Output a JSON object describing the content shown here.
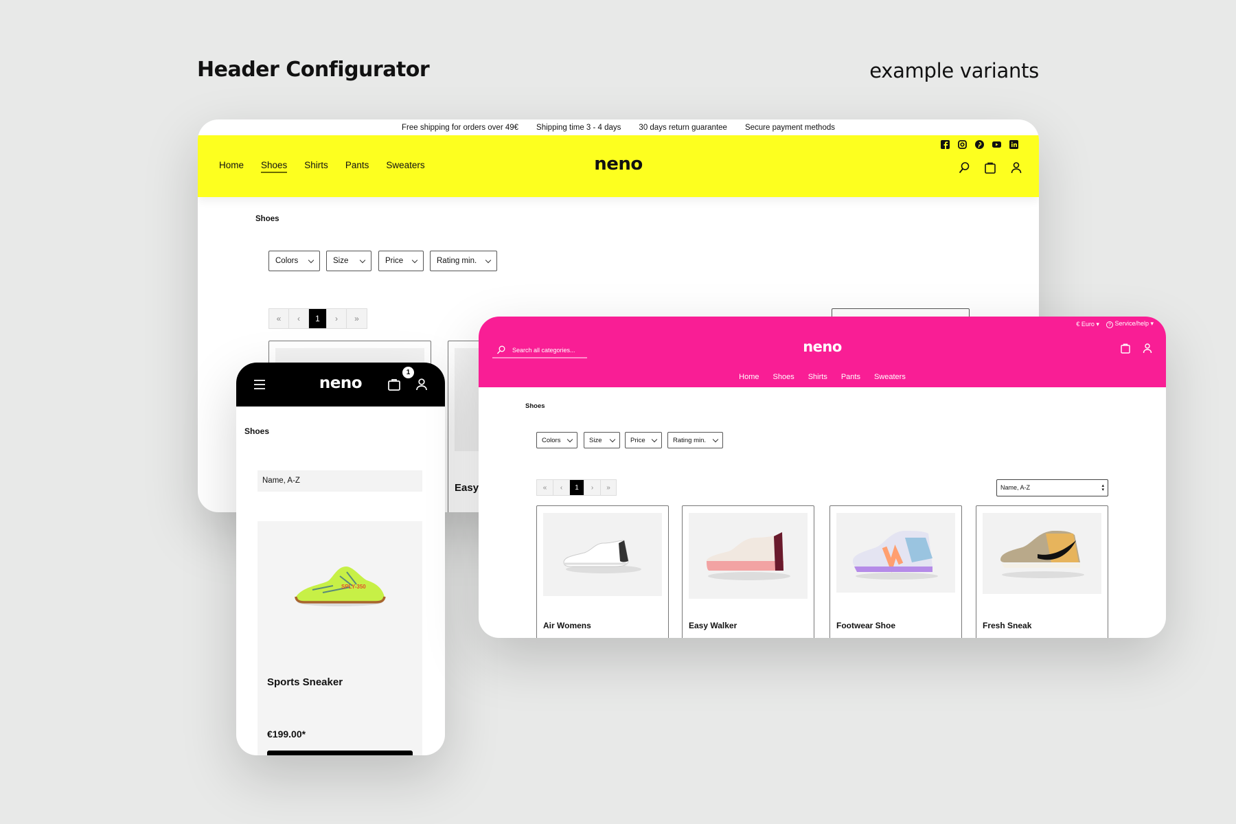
{
  "page": {
    "title": "Header Configurator",
    "subtitle": "example variants"
  },
  "colors": {
    "yellow_header": "#fdff1f",
    "pink_header": "#f91e95",
    "mobile_header": "#000000",
    "background": "#e8e9e8"
  },
  "yellow_variant": {
    "topbar": [
      "Free shipping for orders over 49€",
      "Shipping time 3 - 4 days",
      "30 days return guarantee",
      "Secure payment methods"
    ],
    "social_icons": [
      "facebook-icon",
      "instagram-icon",
      "pinterest-icon",
      "youtube-icon",
      "linkedin-icon"
    ],
    "nav": [
      "Home",
      "Shoes",
      "Shirts",
      "Pants",
      "Sweaters"
    ],
    "active_nav": "Shoes",
    "logo": "neno",
    "header_icons": [
      "search-icon",
      "bag-icon",
      "user-icon"
    ],
    "breadcrumb": "Shoes",
    "filters": [
      "Colors",
      "Size",
      "Price",
      "Rating min."
    ],
    "pagination": {
      "first": "«",
      "prev": "‹",
      "current": "1",
      "next": "›",
      "last": "»"
    },
    "partial_product": "Easy"
  },
  "pink_variant": {
    "currency": "€ Euro",
    "service": "Service/help",
    "search_placeholder": "Search all categories...",
    "logo": "neno",
    "nav": [
      "Home",
      "Shoes",
      "Shirts",
      "Pants",
      "Sweaters"
    ],
    "breadcrumb": "Shoes",
    "filters": [
      "Colors",
      "Size",
      "Price",
      "Rating min."
    ],
    "pagination": {
      "first": "«",
      "prev": "‹",
      "current": "1",
      "next": "›",
      "last": "»"
    },
    "sort": "Name, A-Z",
    "products": [
      {
        "name": "Air Womens"
      },
      {
        "name": "Easy Walker"
      },
      {
        "name": "Footwear Shoe"
      },
      {
        "name": "Fresh Sneak"
      }
    ]
  },
  "mobile_variant": {
    "logo": "neno",
    "cart_count": "1",
    "breadcrumb": "Shoes",
    "sort": "Name, A-Z",
    "product": {
      "name": "Sports Sneaker",
      "price": "€199.00*",
      "print": "SPLY-350"
    }
  }
}
